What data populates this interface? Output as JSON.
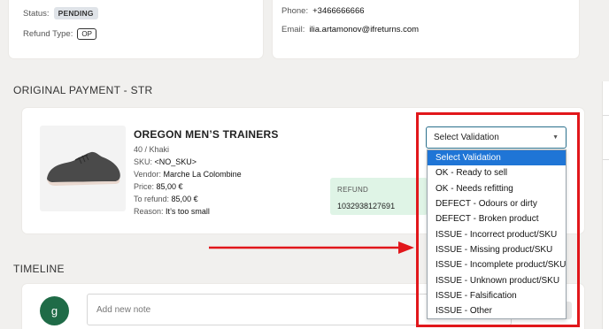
{
  "top_left": {
    "status_label": "Status:",
    "status_badge": "PENDING",
    "refund_type_label": "Refund Type:",
    "refund_type_badge": "OP"
  },
  "top_right": {
    "phone_label": "Phone:",
    "phone_value": "+3466666666",
    "email_label": "Email:",
    "email_value": "ilia.artamonov@ifreturns.com"
  },
  "payment": {
    "section_title": "ORIGINAL PAYMENT - STR",
    "product": {
      "title": "OREGON MEN’S TRAINERS",
      "variant": "40 / Khaki",
      "sku_label": "SKU:",
      "sku_value": "<NO_SKU>",
      "vendor_label": "Vendor:",
      "vendor_value": "Marche La Colombine",
      "price_label": "Price:",
      "price_value": "85,00 €",
      "to_refund_label": "To refund:",
      "to_refund_value": "85,00 €",
      "reason_label": "Reason:",
      "reason_value": "It’s too small"
    },
    "refund": {
      "label": "REFUND",
      "value": "1032938127691"
    },
    "validation": {
      "selected": "Select Validation",
      "options": [
        "Select Validation",
        "OK - Ready to sell",
        "OK - Needs refitting",
        "DEFECT - Odours or dirty",
        "DEFECT - Broken product",
        "ISSUE - Incorrect product/SKU",
        "ISSUE - Missing product/SKU",
        "ISSUE - Incomplete product/SKU",
        "ISSUE - Unknown product/SKU",
        "ISSUE - Falsification",
        "ISSUE - Other"
      ]
    }
  },
  "timeline": {
    "section_title": "TIMELINE",
    "avatar_initial": "g",
    "note_placeholder": "Add new note"
  },
  "colors": {
    "accent": "#1f75d6",
    "highlight": "#e1171b",
    "avatar": "#1f6b47",
    "refund_bg": "#dff4e6"
  },
  "icons": {
    "select_caret": "chevron-down-icon",
    "annotation_arrow": "arrow-right-icon"
  }
}
